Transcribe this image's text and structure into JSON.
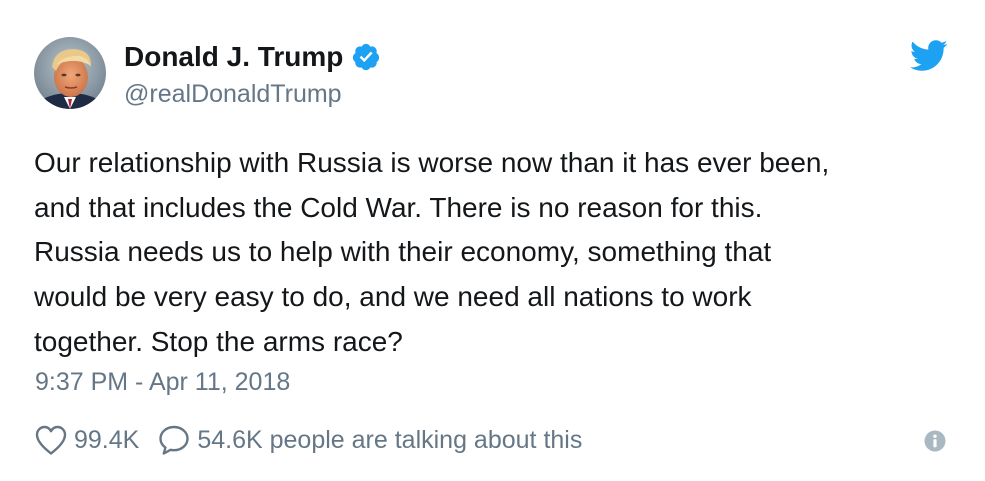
{
  "author": {
    "display_name": "Donald J. Trump",
    "handle": "@realDonaldTrump",
    "verified": true
  },
  "tweet": {
    "lines": [
      "Our relationship with Russia is worse now than it has ever been,",
      "and that includes the Cold War. There is no reason for this.",
      "Russia needs us to help with their economy, something that",
      "would be very easy to do, and we need all nations to work",
      "together. Stop the arms race?"
    ],
    "timestamp": "9:37 PM - Apr 11, 2018"
  },
  "engagement": {
    "likes": "99.4K",
    "talking_summary": "54.6K people are talking about this"
  },
  "icons": {
    "verified": "verified-badge-icon",
    "brand": "twitter-bird-icon",
    "like": "heart-icon",
    "reply": "speech-bubble-icon",
    "info": "info-icon"
  },
  "colors": {
    "brand_blue": "#1da1f2",
    "text_primary": "#14171a",
    "text_secondary": "#657786",
    "info_gray": "#aab8c2"
  }
}
